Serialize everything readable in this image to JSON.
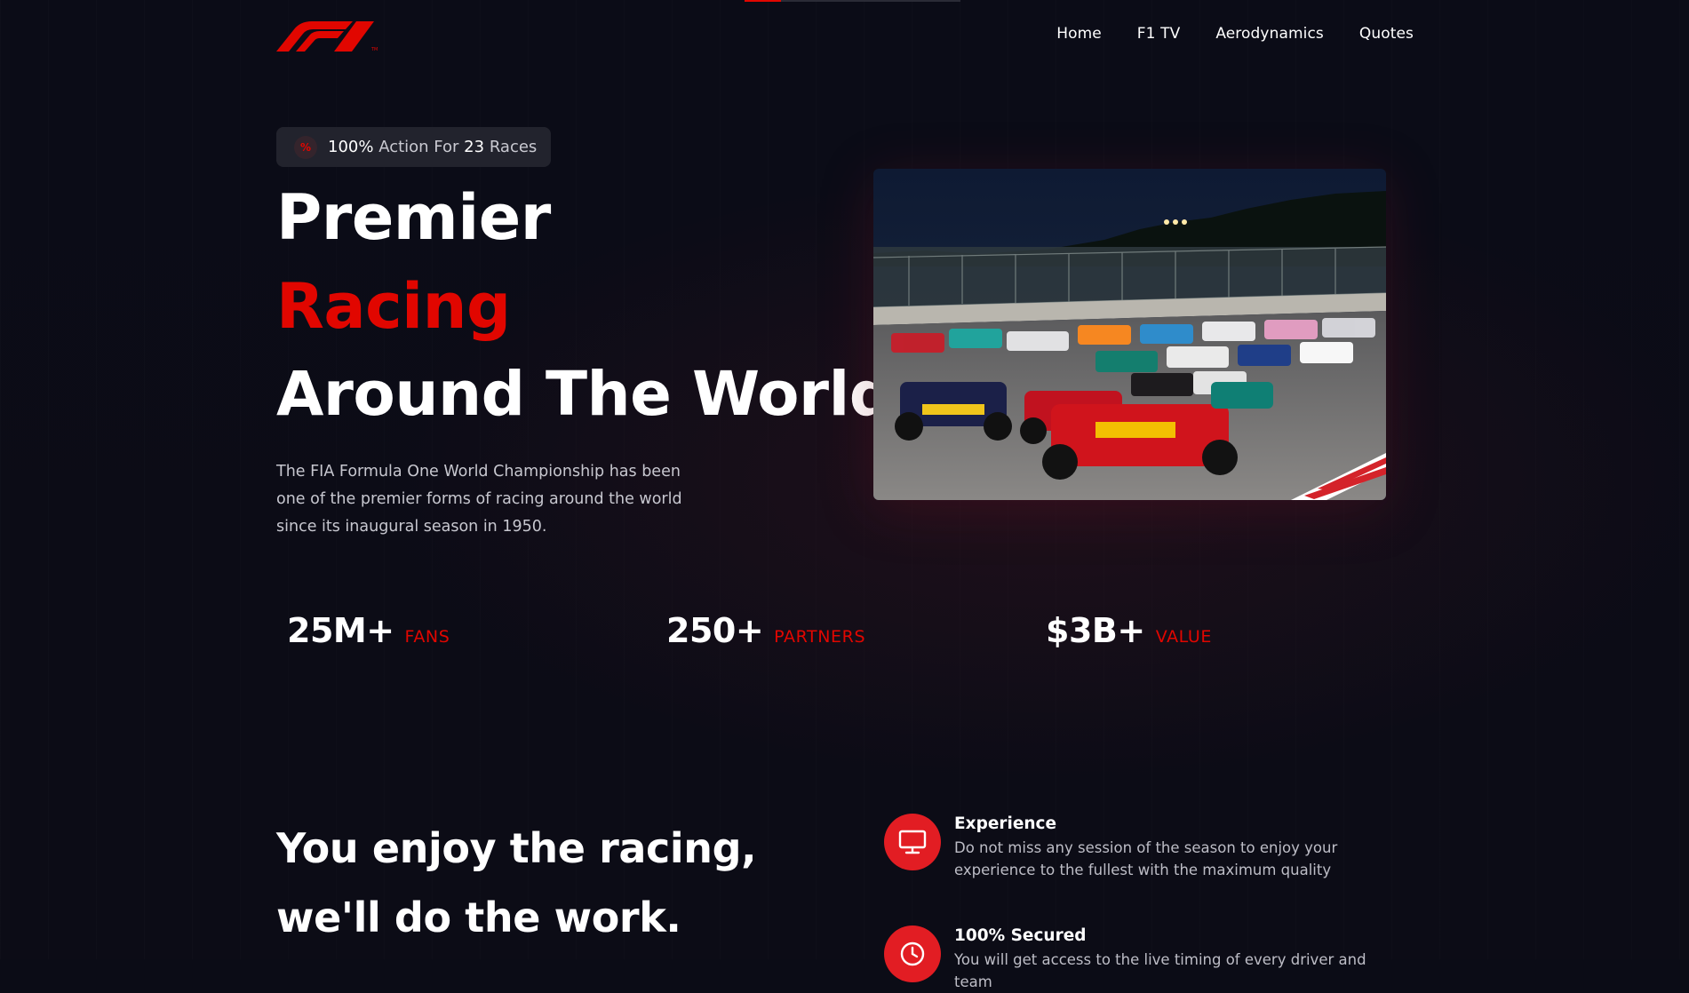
{
  "scroll_indicator": {
    "progress": 0.17
  },
  "header": {
    "logo_text": "F1",
    "nav": [
      "Home",
      "F1 TV",
      "Aerodynamics",
      "Quotes"
    ]
  },
  "hero": {
    "pill": {
      "icon": "percent-icon",
      "n1": "100%",
      "t1": "Action For",
      "n2": "23",
      "t2": "Races"
    },
    "headline_1": "Premier",
    "headline_2": "Racing",
    "headline_3": "Around The World.",
    "description": "The FIA Formula One World Championship has been one of the premier forms of racing around the world since its inaugural season in 1950."
  },
  "stats": [
    {
      "value": "25M+",
      "label": "FANS"
    },
    {
      "value": "250+",
      "label": "PARTNERS"
    },
    {
      "value": "$3B+",
      "label": "VALUE"
    }
  ],
  "section2": {
    "title": "You enjoy the racing, we'll do the work.",
    "features": [
      {
        "icon": "monitor-icon",
        "title": "Experience",
        "description": "Do not miss any session of the season to enjoy your experience to the fullest with the maximum quality"
      },
      {
        "icon": "clock-icon",
        "title": "100% Secured",
        "description": "You will get access to the live timing of every driver and team"
      }
    ]
  },
  "colors": {
    "accent": "#e10600",
    "background": "#0b0c16",
    "pill_bg": "#22232d",
    "text_muted": "#c7c7cf",
    "feature_icon_bg": "#e21d23"
  }
}
